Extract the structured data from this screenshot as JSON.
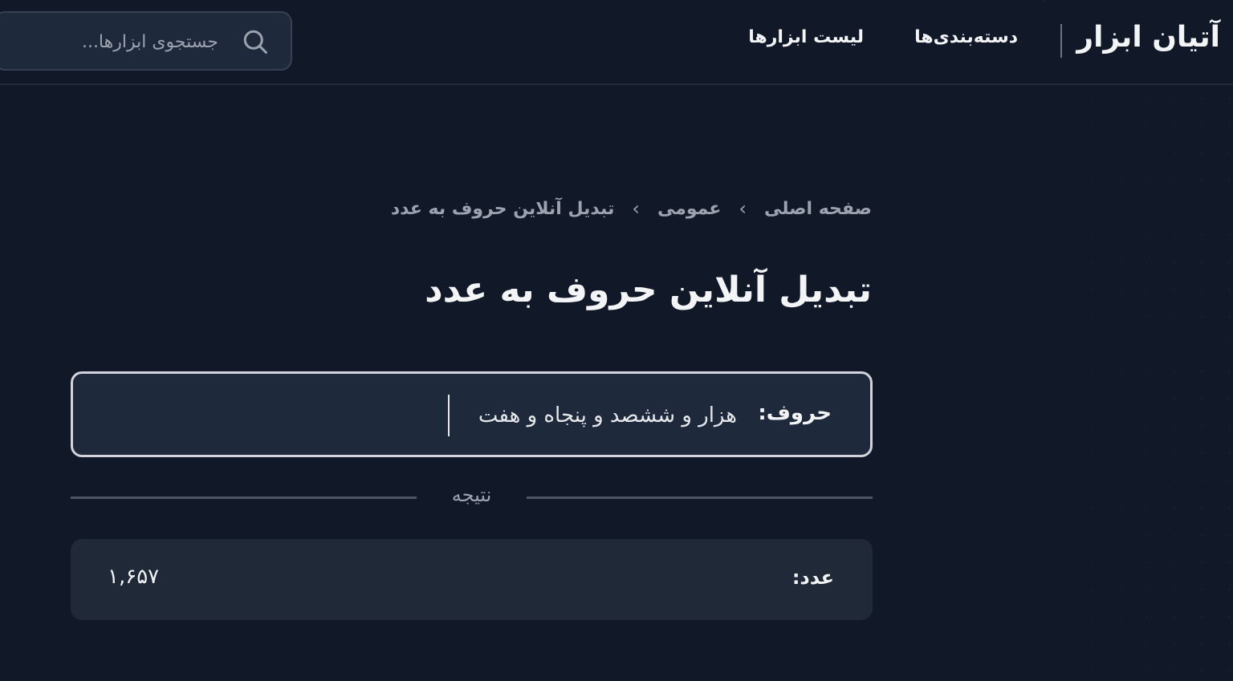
{
  "header": {
    "logo": "آتیان ابزار",
    "nav": {
      "categories": "دسته‌بندی‌ها",
      "tools": "لیست ابزارها"
    },
    "search": {
      "placeholder": "جستجوی ابزارها..."
    }
  },
  "breadcrumb": {
    "home": "صفحه اصلی",
    "category": "عمومی",
    "current": "تبدیل آنلاین حروف به عدد",
    "separator": "›"
  },
  "page": {
    "title": "تبدیل آنلاین حروف به عدد"
  },
  "converter": {
    "input_label": "حروف:",
    "input_value": "هزار و ششصد و پنجاه و هفت",
    "result_heading": "نتیجه",
    "result_label": "عدد:",
    "result_value": "۱,۶۵۷"
  },
  "colors": {
    "background": "#111827",
    "card": "#1e293b",
    "result_card": "#1f2937",
    "muted_text": "#9ca3af"
  }
}
